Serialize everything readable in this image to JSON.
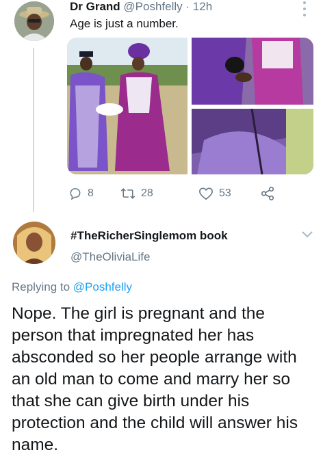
{
  "tweet1": {
    "display_name": "Dr Grand",
    "handle": "@Poshfelly",
    "time": " · 12h",
    "text": "Age is just a number.",
    "media_icon": "photo-grid",
    "actions": {
      "reply_count": "8",
      "retweet_count": "28",
      "like_count": "53",
      "reply_icon": "reply-icon",
      "retweet_icon": "retweet-icon",
      "like_icon": "heart-icon",
      "share_icon": "share-icon"
    }
  },
  "tweet2": {
    "display_name": "#TheRicherSinglemom book",
    "handle": "@TheOliviaLife",
    "replying_prefix": "Replying to ",
    "replying_to": "@Poshfelly",
    "text": "Nope. The girl is pregnant and the person that impregnated her has absconded so her people arrange with an old man to come and marry her so that she can give birth under his protection and the child will answer his name."
  },
  "colors": {
    "text_primary": "#14171a",
    "text_secondary": "#657786",
    "link": "#1da1f2",
    "divider": "#cfd9de"
  }
}
